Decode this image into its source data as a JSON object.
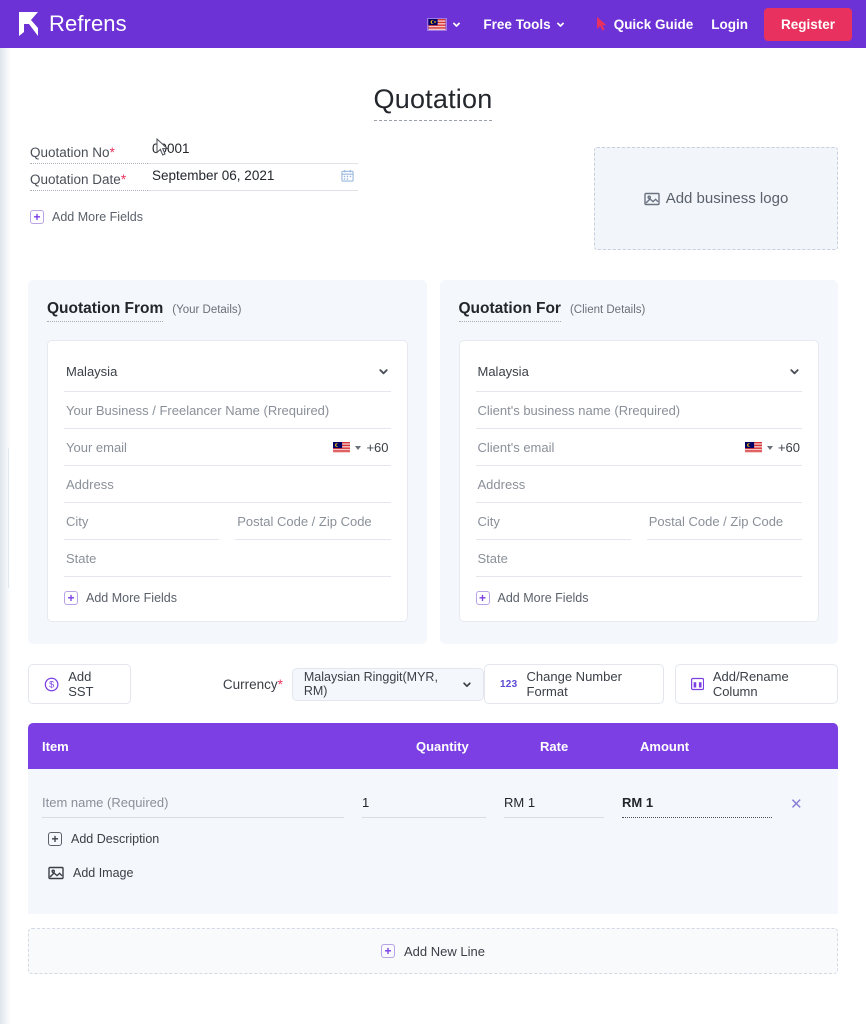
{
  "navbar": {
    "brand": "Refrens",
    "brand_mark_icon": "refrens-r-logo",
    "flag_icon": "malaysia-flag-icon",
    "flag_caret_icon": "chevron-down-icon",
    "free_tools": "Free Tools",
    "free_tools_caret_icon": "chevron-down-icon",
    "quick_guide_icon": "cursor-pointer-icon",
    "quick_guide": "Quick Guide",
    "login": "Login",
    "register": "Register",
    "bg_color": "#6D32D6",
    "register_color": "#E8315E"
  },
  "document": {
    "title": "Quotation"
  },
  "meta": {
    "number_label": "Quotation No",
    "number_required": "*",
    "number_value": "00001",
    "date_label": "Quotation Date",
    "date_required": "*",
    "date_value": "September 06, 2021",
    "calendar_icon": "calendar-icon",
    "add_more_fields": "Add More Fields",
    "plus_icon": "plus-icon"
  },
  "logo_drop": {
    "label": "Add business logo",
    "icon": "image-placeholder-icon"
  },
  "parties": [
    {
      "title": "Quotation From",
      "subtitle": "(Your Details)",
      "country": "Malaysia",
      "country_caret_icon": "chevron-down-icon",
      "business_name_placeholder": "Your Business / Freelancer Name (Rrequired)",
      "email_placeholder": "Your email",
      "phone_flag_icon": "malaysia-flag-icon",
      "phone_caret_icon": "caret-down-icon",
      "phone_code": "+60",
      "address_placeholder": "Address",
      "city_placeholder": "City",
      "postal_placeholder": "Postal Code / Zip Code",
      "state_placeholder": "State",
      "add_more_fields": "Add More Fields",
      "plus_icon": "plus-icon"
    },
    {
      "title": "Quotation For",
      "subtitle": "(Client Details)",
      "country": "Malaysia",
      "country_caret_icon": "chevron-down-icon",
      "business_name_placeholder": "Client's business name (Rrequired)",
      "email_placeholder": "Client's email",
      "phone_flag_icon": "malaysia-flag-icon",
      "phone_caret_icon": "caret-down-icon",
      "phone_code": "+60",
      "address_placeholder": "Address",
      "city_placeholder": "City",
      "postal_placeholder": "Postal Code / Zip Code",
      "state_placeholder": "State",
      "add_more_fields": "Add More Fields",
      "plus_icon": "plus-icon"
    }
  ],
  "toolbar": {
    "add_sst": "Add SST",
    "sst_icon": "dollar-circle-icon",
    "currency_label": "Currency",
    "currency_required": "*",
    "currency_value": "Malaysian Ringgit(MYR, RM)",
    "currency_caret_icon": "chevron-down-icon",
    "number_format": "Change Number Format",
    "number_format_icon": "123-icon",
    "add_column": "Add/Rename Column",
    "add_column_icon": "columns-icon"
  },
  "items_table": {
    "columns": [
      "Item",
      "Quantity",
      "Rate",
      "Amount"
    ],
    "rows": [
      {
        "item": "Item name (Required)",
        "quantity": "1",
        "rate": "RM 1",
        "amount": "RM 1",
        "delete_icon": "close-icon"
      }
    ],
    "add_description": "Add Description",
    "add_description_icon": "plus-icon",
    "add_image": "Add Image",
    "add_image_icon": "image-icon",
    "add_new_line": "Add New Line",
    "add_new_line_icon": "plus-icon",
    "header_color": "#7B3FE4"
  }
}
